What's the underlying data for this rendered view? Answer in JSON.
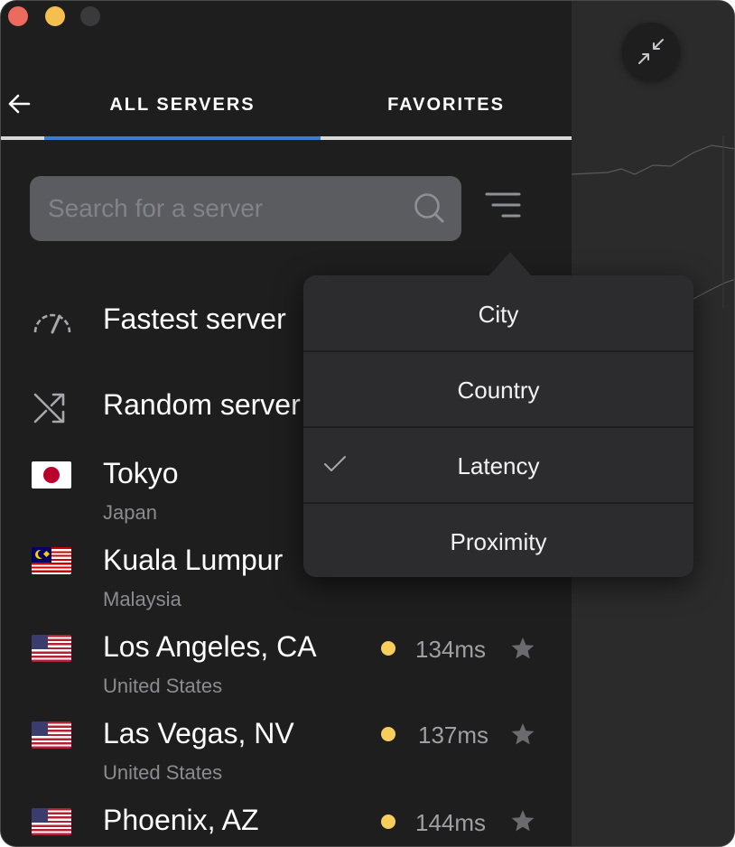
{
  "tabs": {
    "all_servers": "ALL SERVERS",
    "favorites": "FAVORITES"
  },
  "search": {
    "placeholder": "Search for a server"
  },
  "quick_connect": {
    "fastest": "Fastest server",
    "random": "Random server"
  },
  "servers": [
    {
      "city": "Tokyo",
      "country": "Japan",
      "flag": "japan",
      "latency": "",
      "favorite": false
    },
    {
      "city": "Kuala Lumpur",
      "country": "Malaysia",
      "flag": "malaysia",
      "latency": "",
      "favorite": false
    },
    {
      "city": "Los Angeles, CA",
      "country": "United States",
      "flag": "usa",
      "latency": "134ms",
      "favorite": false
    },
    {
      "city": "Las Vegas, NV",
      "country": "United States",
      "flag": "usa",
      "latency": "137ms",
      "favorite": false
    },
    {
      "city": "Phoenix, AZ",
      "country": "",
      "flag": "usa",
      "latency": "144ms",
      "favorite": false
    }
  ],
  "sort_menu": {
    "options": [
      "City",
      "Country",
      "Latency",
      "Proximity"
    ],
    "selected": "Latency"
  },
  "colors": {
    "accent": "#3d7bd8",
    "latency_dot": "#f7ce5b",
    "background": "#1e1e1f",
    "search_bg": "#5b5c60"
  },
  "icons": {
    "back": "arrow-left-icon",
    "search": "search-icon",
    "filter": "sort-lines-icon",
    "fastest": "speedometer-icon",
    "random": "shuffle-icon",
    "favorite": "star-icon",
    "minimize": "collapse-arrows-icon",
    "selected": "checkmark-icon"
  }
}
